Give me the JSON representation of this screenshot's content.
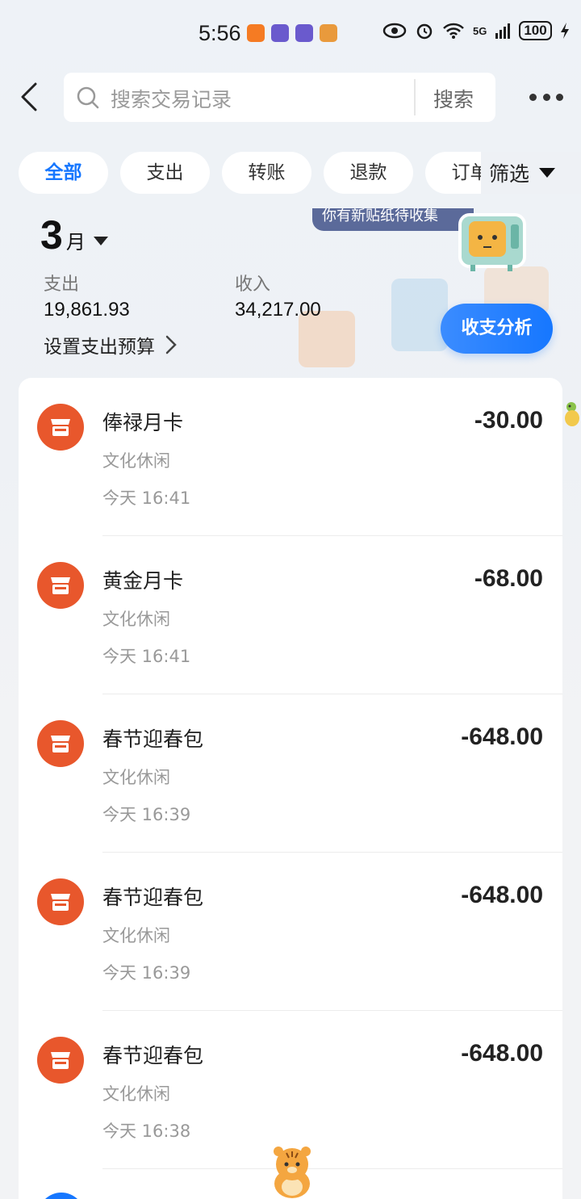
{
  "status_bar": {
    "time": "5:56",
    "network_label": "5G",
    "battery": "100"
  },
  "header": {
    "search_placeholder": "搜索交易记录",
    "search_button": "搜索"
  },
  "tabs": [
    {
      "label": "全部",
      "active": true
    },
    {
      "label": "支出",
      "active": false
    },
    {
      "label": "转账",
      "active": false
    },
    {
      "label": "退款",
      "active": false
    },
    {
      "label": "订单",
      "active": false
    }
  ],
  "filter": {
    "label": "筛选"
  },
  "summary": {
    "month_number": "3",
    "month_unit": "月",
    "expense_label": "支出",
    "expense_value": "19,861.93",
    "income_label": "收入",
    "income_value": "34,217.00",
    "budget_label": "设置支出预算",
    "analysis_button": "收支分析",
    "sticker_banner": "你有新贴纸待收集"
  },
  "transactions": [
    {
      "title": "俸禄月卡",
      "category": "文化休闲",
      "time": "今天 16:41",
      "amount": "-30.00"
    },
    {
      "title": "黄金月卡",
      "category": "文化休闲",
      "time": "今天 16:41",
      "amount": "-68.00"
    },
    {
      "title": "春节迎春包",
      "category": "文化休闲",
      "time": "今天 16:39",
      "amount": "-648.00"
    },
    {
      "title": "春节迎春包",
      "category": "文化休闲",
      "time": "今天 16:39",
      "amount": "-648.00"
    },
    {
      "title": "春节迎春包",
      "category": "文化休闲",
      "time": "今天 16:38",
      "amount": "-648.00"
    }
  ],
  "colors": {
    "accent": "#1677ff",
    "merchant_icon": "#e8572c",
    "background": "#f2f3f5"
  },
  "icons": [
    "back-arrow-icon",
    "search-icon",
    "more-icon",
    "caret-down-icon",
    "chevron-right-icon",
    "store-icon"
  ]
}
